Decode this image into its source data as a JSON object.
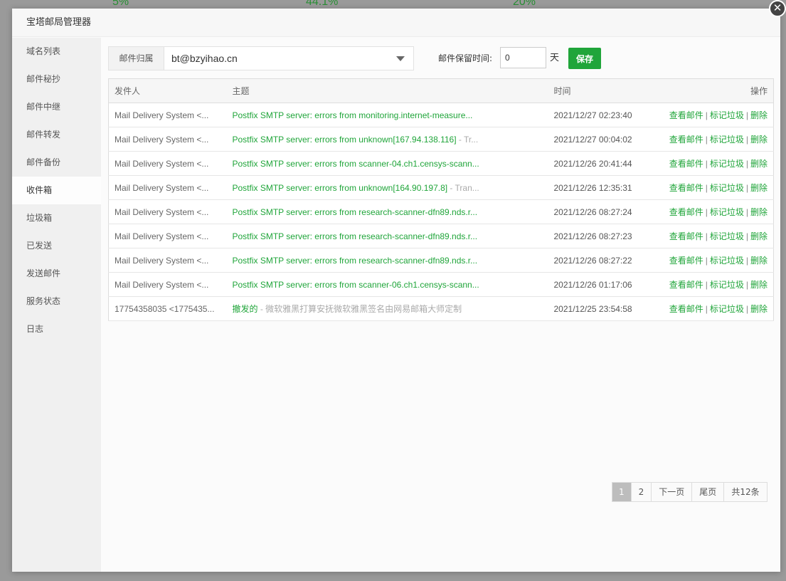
{
  "background": {
    "stats": [
      "5%",
      "44.1%",
      "20%"
    ]
  },
  "modal": {
    "title": "宝塔邮局管理器",
    "close_label": "✕"
  },
  "sidebar": {
    "items": [
      {
        "label": "域名列表"
      },
      {
        "label": "邮件秘抄"
      },
      {
        "label": "邮件中继"
      },
      {
        "label": "邮件转发"
      },
      {
        "label": "邮件备份"
      },
      {
        "label": "收件箱",
        "active": true
      },
      {
        "label": "垃圾箱"
      },
      {
        "label": "已发送"
      },
      {
        "label": "发送邮件"
      },
      {
        "label": "服务状态"
      },
      {
        "label": "日志"
      }
    ]
  },
  "toolbar": {
    "domain_label": "邮件归属",
    "domain_value": "bt@bzyihao.cn",
    "retention_label": "邮件保留时间:",
    "retention_value": "0",
    "retention_unit": "天",
    "save_label": "保存"
  },
  "table": {
    "headers": {
      "sender": "发件人",
      "subject": "主题",
      "time": "时间",
      "ops": "操作"
    },
    "ops": {
      "view": "查看邮件",
      "spam": "标记垃圾",
      "delete": "删除",
      "sep": "|"
    },
    "rows": [
      {
        "sender": "Mail Delivery System <...",
        "subject": "Postfix SMTP server: errors from monitoring.internet-measure...",
        "extra": "",
        "time": "2021/12/27 02:23:40"
      },
      {
        "sender": "Mail Delivery System <...",
        "subject": "Postfix SMTP server: errors from unknown[167.94.138.116]",
        "extra": " - Tr...",
        "time": "2021/12/27 00:04:02"
      },
      {
        "sender": "Mail Delivery System <...",
        "subject": "Postfix SMTP server: errors from scanner-04.ch1.censys-scann...",
        "extra": "",
        "time": "2021/12/26 20:41:44"
      },
      {
        "sender": "Mail Delivery System <...",
        "subject": "Postfix SMTP server: errors from unknown[164.90.197.8]",
        "extra": " - Tran...",
        "time": "2021/12/26 12:35:31"
      },
      {
        "sender": "Mail Delivery System <...",
        "subject": "Postfix SMTP server: errors from research-scanner-dfn89.nds.r...",
        "extra": "",
        "time": "2021/12/26 08:27:24"
      },
      {
        "sender": "Mail Delivery System <...",
        "subject": "Postfix SMTP server: errors from research-scanner-dfn89.nds.r...",
        "extra": "",
        "time": "2021/12/26 08:27:23"
      },
      {
        "sender": "Mail Delivery System <...",
        "subject": "Postfix SMTP server: errors from research-scanner-dfn89.nds.r...",
        "extra": "",
        "time": "2021/12/26 08:27:22"
      },
      {
        "sender": "Mail Delivery System <...",
        "subject": "Postfix SMTP server: errors from scanner-06.ch1.censys-scann...",
        "extra": "",
        "time": "2021/12/26 01:17:06"
      },
      {
        "sender": "17754358035 <1775435...",
        "subject": "撤发的",
        "extra": " - 微软雅黑打算安抚微软雅黑签名由网易邮箱大师定制",
        "time": "2021/12/25 23:54:58"
      }
    ]
  },
  "pagination": {
    "pages": [
      "1",
      "2"
    ],
    "current": "1",
    "next_label": "下一页",
    "last_label": "尾页",
    "total_label": "共12条"
  }
}
